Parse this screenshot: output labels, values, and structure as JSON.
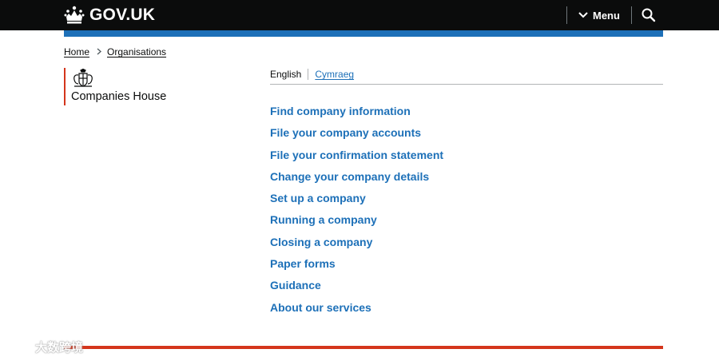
{
  "header": {
    "logo_text": "GOV.UK",
    "menu_label": "Menu",
    "search_icon": "search-icon",
    "crown_icon": "crown-icon"
  },
  "breadcrumb": {
    "items": [
      "Home",
      "Organisations"
    ]
  },
  "organisation": {
    "name": "Companies House",
    "crest_icon": "royal-crest-icon"
  },
  "language": {
    "current": "English",
    "alternate": "Cymraeg"
  },
  "nav": {
    "links": [
      "Find company information",
      "File your company accounts",
      "File your confirmation statement",
      "Change your company details",
      "Set up a company",
      "Running a company",
      "Closing a company",
      "Paper forms",
      "Guidance",
      "About our services"
    ]
  },
  "watermark": {
    "text": "大数跨境"
  },
  "colors": {
    "header_bg": "#0b0c0c",
    "brand_blue": "#1d70b8",
    "org_red": "#d4351c",
    "text": "#0b0c0c"
  }
}
